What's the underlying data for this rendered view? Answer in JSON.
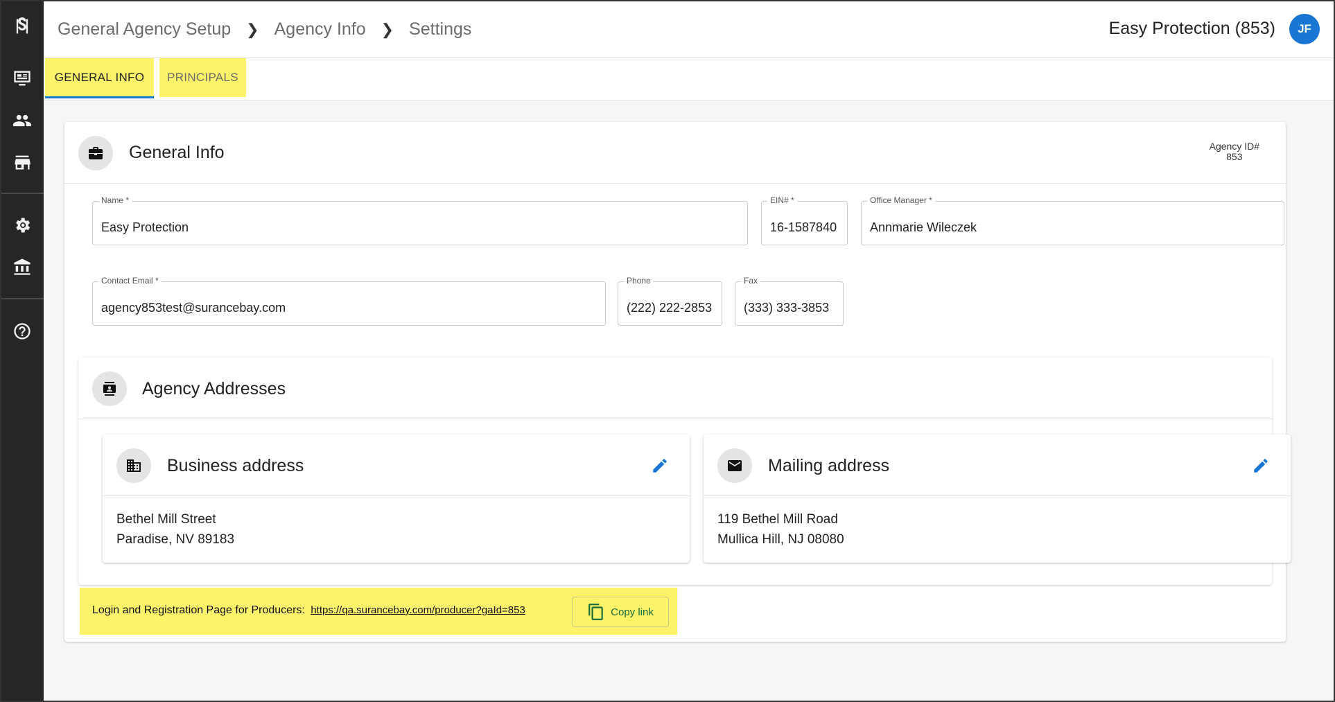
{
  "breadcrumb": [
    "General Agency Setup",
    "Agency Info",
    "Settings"
  ],
  "header": {
    "company": "Easy Protection (853)",
    "avatar_initials": "JF"
  },
  "tabs": [
    {
      "label": "GENERAL INFO",
      "active": true
    },
    {
      "label": "PRINCIPALS",
      "active": false
    }
  ],
  "general_info": {
    "title": "General Info",
    "agency_id_label": "Agency ID#",
    "agency_id_value": "853",
    "fields": {
      "name": {
        "label": "Name *",
        "value": "Easy Protection"
      },
      "ein": {
        "label": "EIN# *",
        "value": "16-1587840"
      },
      "office_manager": {
        "label": "Office Manager *",
        "value": "Annmarie Wileczek"
      },
      "contact_email": {
        "label": "Contact Email *",
        "value": "agency853test@surancebay.com"
      },
      "phone": {
        "label": "Phone",
        "value": "(222) 222-2853"
      },
      "fax": {
        "label": "Fax",
        "value": "(333) 333-3853"
      }
    }
  },
  "addresses": {
    "title": "Agency Addresses",
    "business": {
      "title": "Business address",
      "line1": "Bethel Mill Street",
      "line2": "Paradise, NV 89183"
    },
    "mailing": {
      "title": "Mailing address",
      "line1": "119 Bethel Mill Road",
      "line2": "Mullica Hill, NJ 08080"
    }
  },
  "producer_link": {
    "label": "Login and Registration Page for Producers:",
    "url": "https://qa.surancebay.com/producer?gaId=853",
    "copy_label": "Copy link"
  },
  "colors": {
    "accent": "#1976d2",
    "highlight": "#fdf36b",
    "rail": "#262626",
    "copy": "#1a6b3a"
  }
}
